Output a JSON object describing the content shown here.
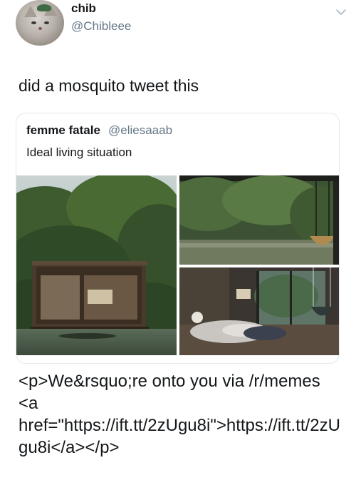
{
  "tweet": {
    "display_name": "chib",
    "handle": "@Chibleee",
    "text": "did a mosquito tweet this",
    "menu_icon": "chevron-down-icon",
    "avatar": "cat-avatar"
  },
  "quoted_tweet": {
    "display_name": "femme fatale",
    "handle": "@eliesaaab",
    "text": "Ideal living situation",
    "media": [
      {
        "name": "jungle-cabin-exterior-photo"
      },
      {
        "name": "jungle-river-swing-photo"
      },
      {
        "name": "cabin-bedroom-interior-photo"
      }
    ]
  },
  "caption": "<p>We&rsquo;re onto you via /r/memes <a href=\"https://ift.tt/2zUgu8i\">https://ift.tt/2zUgu8i</a></p>",
  "colors": {
    "text": "#14171a",
    "secondary": "#657786",
    "border": "#e1e8ed"
  }
}
